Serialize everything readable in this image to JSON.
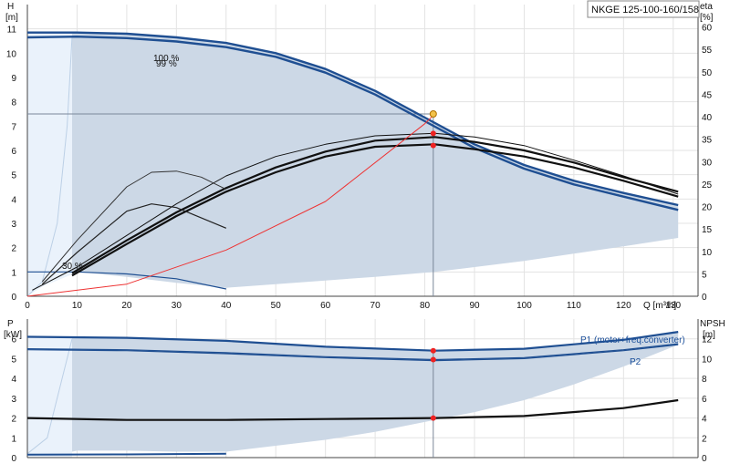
{
  "chart_data": [
    {
      "type": "line",
      "title": "NKGE 125-100-160/158",
      "xlabel": "Q [m³/h]",
      "ylabel": "H",
      "ylabel_unit": "[m]",
      "y2label": "eta",
      "y2label_unit": "[%]",
      "xlim": [
        0,
        135
      ],
      "ylim": [
        0,
        12
      ],
      "y2lim": [
        0,
        65
      ],
      "x_ticks": [
        "0",
        "10",
        "20",
        "30",
        "40",
        "50",
        "60",
        "70",
        "80",
        "90",
        "100",
        "110",
        "120",
        "130"
      ],
      "y_ticks": [
        "0",
        "1",
        "2",
        "3",
        "4",
        "5",
        "6",
        "7",
        "8",
        "9",
        "10",
        "11"
      ],
      "y2_ticks": [
        "0",
        "5",
        "10",
        "15",
        "20",
        "25",
        "30",
        "35",
        "40",
        "45",
        "50",
        "55",
        "60"
      ],
      "grid": true,
      "annotations": [
        "100 %",
        "99 %",
        "30 %"
      ],
      "operating_point": {
        "x": 81.7,
        "y": 7.5
      },
      "series": [
        {
          "values": [
            [
              0,
              10.85
            ],
            [
              10,
              10.85
            ],
            [
              20,
              10.8
            ],
            [
              30,
              10.65
            ],
            [
              40,
              10.42
            ],
            [
              50,
              10.0
            ],
            [
              60,
              9.35
            ],
            [
              70,
              8.45
            ],
            [
              80,
              7.35
            ],
            [
              90,
              6.25
            ],
            [
              100,
              5.4
            ],
            [
              110,
              4.75
            ],
            [
              120,
              4.25
            ],
            [
              131,
              3.75
            ]
          ]
        },
        {
          "values": [
            [
              0,
              10.65
            ],
            [
              10,
              10.68
            ],
            [
              20,
              10.62
            ],
            [
              30,
              10.48
            ],
            [
              40,
              10.25
            ],
            [
              50,
              9.85
            ],
            [
              60,
              9.2
            ],
            [
              70,
              8.3
            ],
            [
              80,
              7.2
            ],
            [
              90,
              6.1
            ],
            [
              100,
              5.25
            ],
            [
              110,
              4.6
            ],
            [
              120,
              4.1
            ],
            [
              131,
              3.55
            ]
          ]
        },
        {
          "values": [
            [
              0,
              1.0
            ],
            [
              10,
              1.0
            ],
            [
              20,
              0.92
            ],
            [
              30,
              0.72
            ],
            [
              40,
              0.3
            ]
          ]
        },
        {
          "values": [
            [
              1,
              0.25
            ],
            [
              10,
              1.2
            ],
            [
              20,
              2.5
            ],
            [
              30,
              3.8
            ],
            [
              40,
              4.95
            ],
            [
              50,
              5.75
            ],
            [
              60,
              6.25
            ],
            [
              70,
              6.6
            ],
            [
              82,
              6.7
            ],
            [
              90,
              6.55
            ],
            [
              100,
              6.2
            ],
            [
              110,
              5.6
            ],
            [
              120,
              4.95
            ],
            [
              131,
              4.2
            ]
          ]
        },
        {
          "values": [
            [
              9,
              0.85
            ],
            [
              20,
              2.15
            ],
            [
              30,
              3.3
            ],
            [
              40,
              4.3
            ],
            [
              50,
              5.1
            ],
            [
              60,
              5.75
            ],
            [
              70,
              6.15
            ],
            [
              82,
              6.25
            ],
            [
              90,
              6.05
            ],
            [
              100,
              5.75
            ],
            [
              110,
              5.3
            ],
            [
              120,
              4.75
            ],
            [
              131,
              4.1
            ]
          ]
        },
        {
          "values": [
            [
              9,
              0.95
            ],
            [
              20,
              2.3
            ],
            [
              30,
              3.45
            ],
            [
              40,
              4.45
            ],
            [
              50,
              5.3
            ],
            [
              60,
              5.95
            ],
            [
              70,
              6.4
            ],
            [
              82,
              6.55
            ],
            [
              90,
              6.35
            ],
            [
              100,
              6.0
            ],
            [
              110,
              5.5
            ],
            [
              120,
              4.9
            ],
            [
              131,
              4.3
            ]
          ]
        },
        {
          "values": [
            [
              3,
              0.6
            ],
            [
              10,
              2.3
            ],
            [
              20,
              4.5
            ],
            [
              25,
              5.1
            ],
            [
              30,
              5.15
            ],
            [
              35,
              4.9
            ],
            [
              40,
              4.4
            ]
          ]
        },
        {
          "values": [
            [
              3,
              0.5
            ],
            [
              10,
              1.8
            ],
            [
              20,
              3.5
            ],
            [
              25,
              3.8
            ],
            [
              30,
              3.65
            ],
            [
              40,
              2.8
            ]
          ]
        },
        {
          "values": [
            [
              0,
              0
            ],
            [
              20,
              0.5
            ],
            [
              40,
              1.9
            ],
            [
              60,
              3.9
            ],
            [
              80,
              7.1
            ],
            [
              82,
              7.5
            ]
          ]
        }
      ]
    },
    {
      "type": "line",
      "ylabel": "P",
      "ylabel_unit": "[kW]",
      "y2label": "NPSH",
      "y2label_unit": "[m]",
      "xlim": [
        0,
        135
      ],
      "ylim": [
        0,
        7
      ],
      "y2lim": [
        0,
        14
      ],
      "y_ticks": [
        "0",
        "1",
        "2",
        "3",
        "4",
        "5",
        "6"
      ],
      "y2_ticks": [
        "0",
        "2",
        "4",
        "6",
        "8",
        "10",
        "12"
      ],
      "grid": true,
      "series": [
        {
          "name": "P1 (motor+freq.converter)",
          "values": [
            [
              0,
              6.1
            ],
            [
              20,
              6.05
            ],
            [
              40,
              5.9
            ],
            [
              60,
              5.6
            ],
            [
              82,
              5.4
            ],
            [
              100,
              5.5
            ],
            [
              120,
              5.95
            ],
            [
              131,
              6.35
            ]
          ]
        },
        {
          "values": [
            [
              0,
              5.5
            ],
            [
              20,
              5.45
            ],
            [
              40,
              5.3
            ],
            [
              60,
              5.1
            ],
            [
              82,
              4.95
            ],
            [
              100,
              5.05
            ],
            [
              120,
              5.45
            ],
            [
              131,
              5.75
            ]
          ]
        },
        {
          "name": "P2",
          "values": [
            [
              0,
              5.45
            ],
            [
              20,
              5.4
            ],
            [
              40,
              5.25
            ],
            [
              60,
              5.05
            ],
            [
              82,
              4.9
            ],
            [
              100,
              5.0
            ],
            [
              120,
              5.4
            ],
            [
              131,
              5.7
            ]
          ]
        },
        {
          "values": [
            [
              0,
              2.0
            ],
            [
              20,
              1.9
            ],
            [
              40,
              1.9
            ],
            [
              60,
              1.95
            ],
            [
              82,
              2.0
            ],
            [
              100,
              2.1
            ],
            [
              120,
              2.5
            ],
            [
              131,
              2.9
            ]
          ]
        },
        {
          "values": [
            [
              0,
              0.15
            ],
            [
              20,
              0.16
            ],
            [
              40,
              0.2
            ]
          ]
        }
      ],
      "points": [
        [
          81.7,
          5.4
        ],
        [
          81.7,
          4.95
        ],
        [
          81.7,
          2.0
        ]
      ]
    }
  ]
}
